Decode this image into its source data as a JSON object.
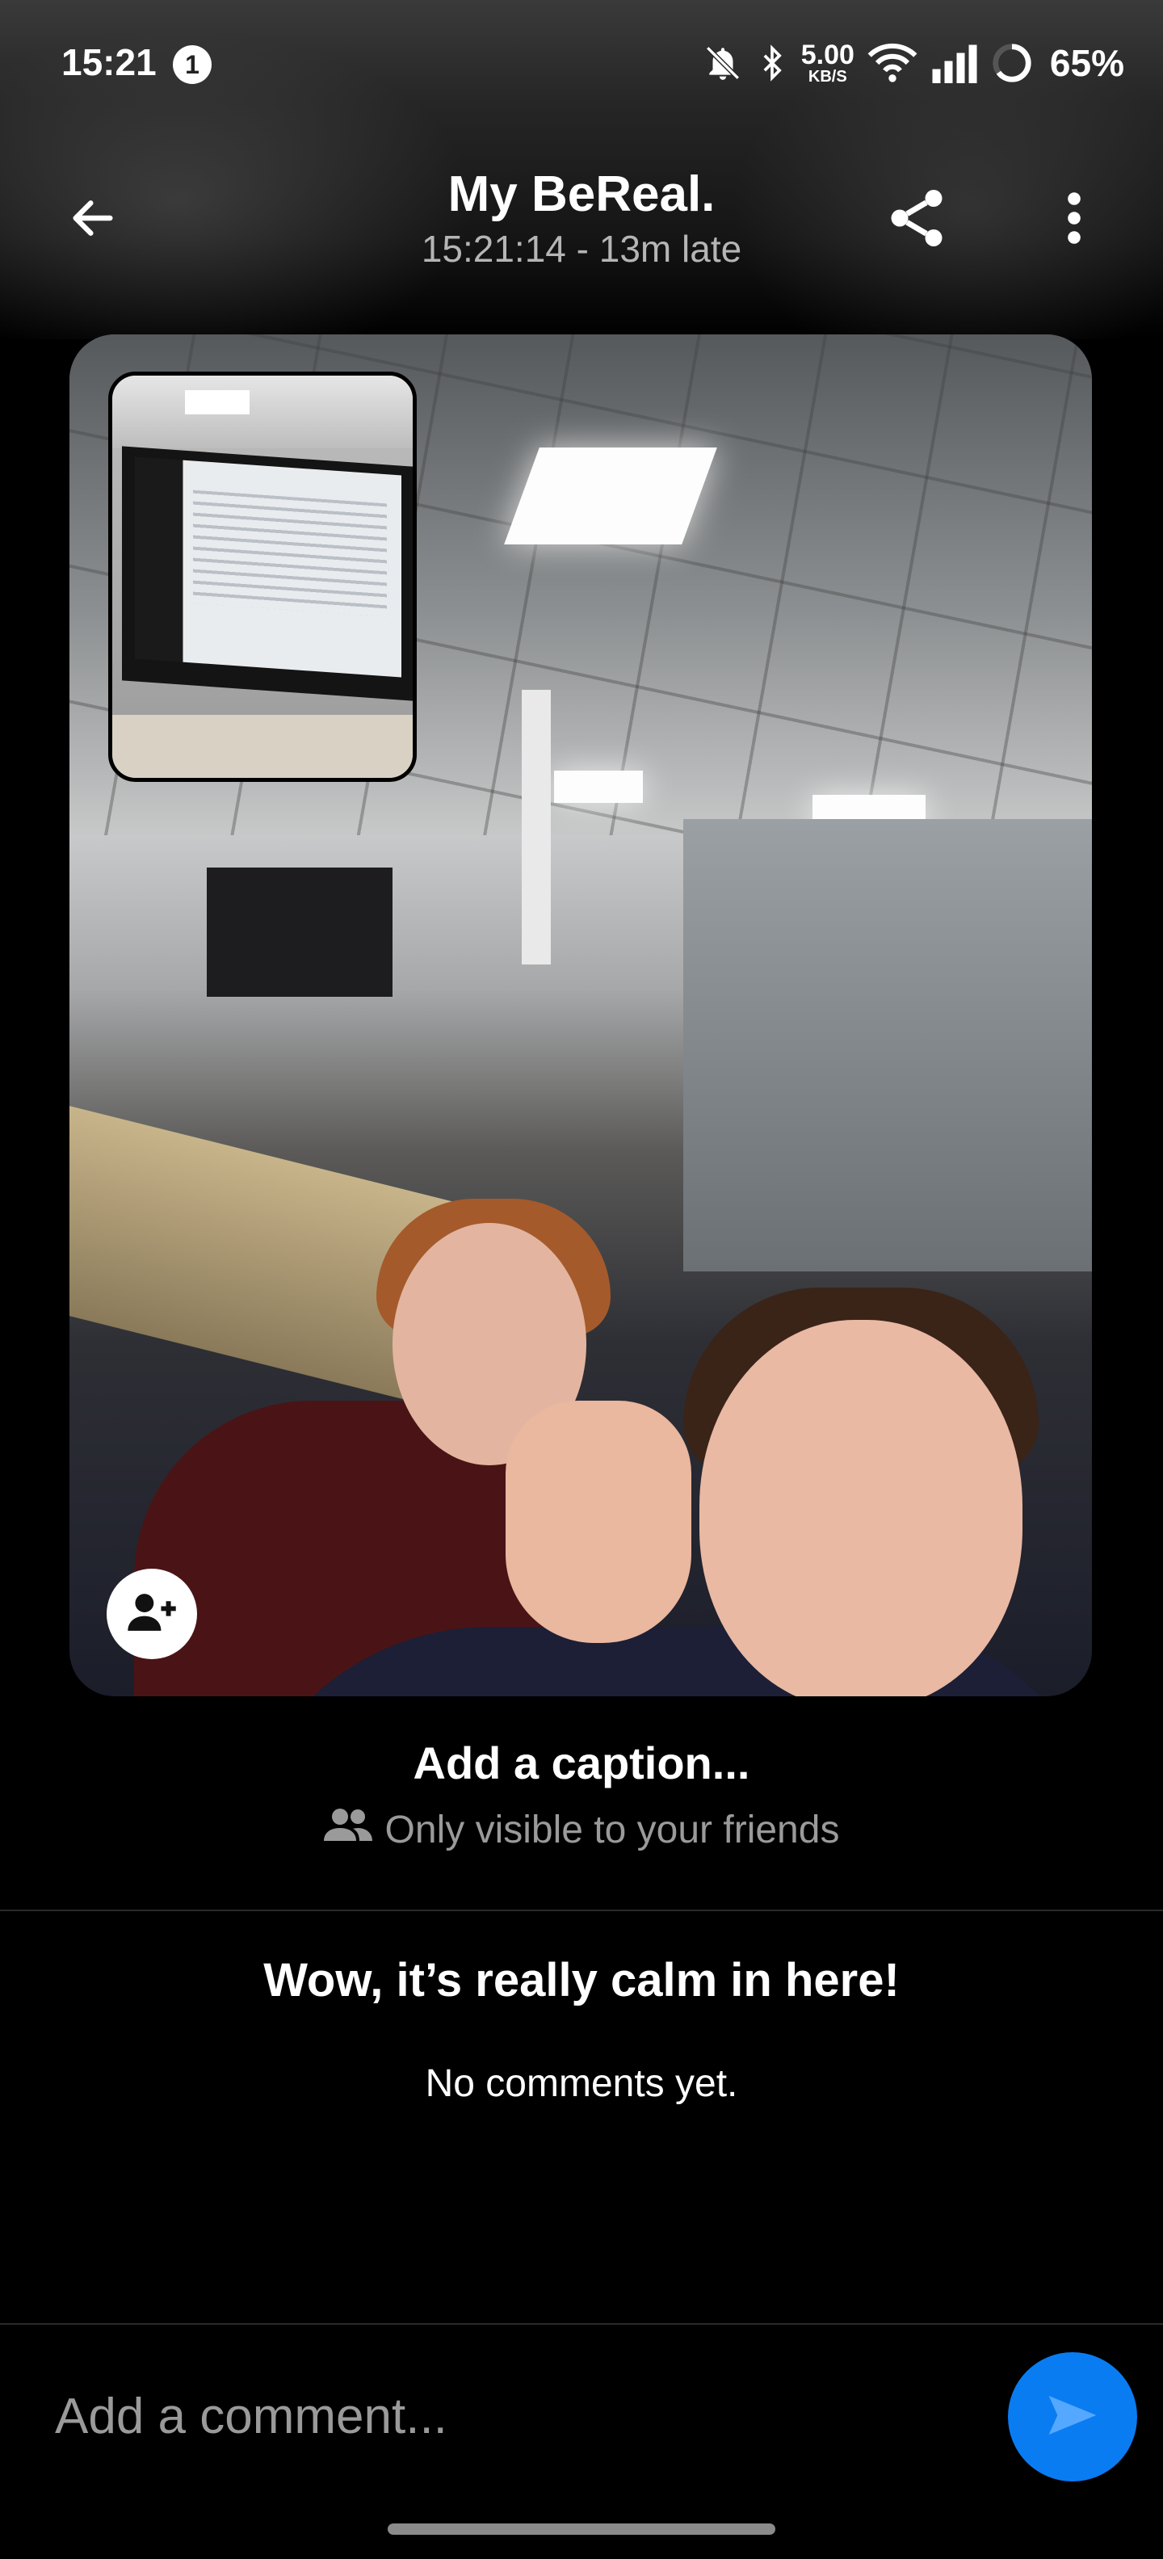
{
  "status_bar": {
    "time": "15:21",
    "notification_count": "1",
    "net_speed_value": "5.00",
    "net_speed_unit": "KB/S",
    "battery": "65%",
    "icons": [
      "bell-off-icon",
      "bluetooth-icon",
      "wifi-icon",
      "signal-icon",
      "battery-ring-icon"
    ]
  },
  "header": {
    "title": "My BeReal.",
    "subtitle": "15:21:14 - 13m late",
    "back_icon": "arrow-left-icon",
    "share_icon": "share-icon",
    "more_icon": "more-vertical-icon"
  },
  "post": {
    "tag_friend_icon": "add-person-icon"
  },
  "caption": {
    "placeholder": "Add a caption...",
    "visibility": "Only visible to your friends",
    "visibility_icon": "friends-icon"
  },
  "comments": {
    "empty_title": "Wow, it’s really calm in here!",
    "empty_subtitle": "No comments yet."
  },
  "comment_bar": {
    "placeholder": "Add a comment...",
    "send_icon": "send-icon",
    "accent_color": "#0a7cf2"
  }
}
